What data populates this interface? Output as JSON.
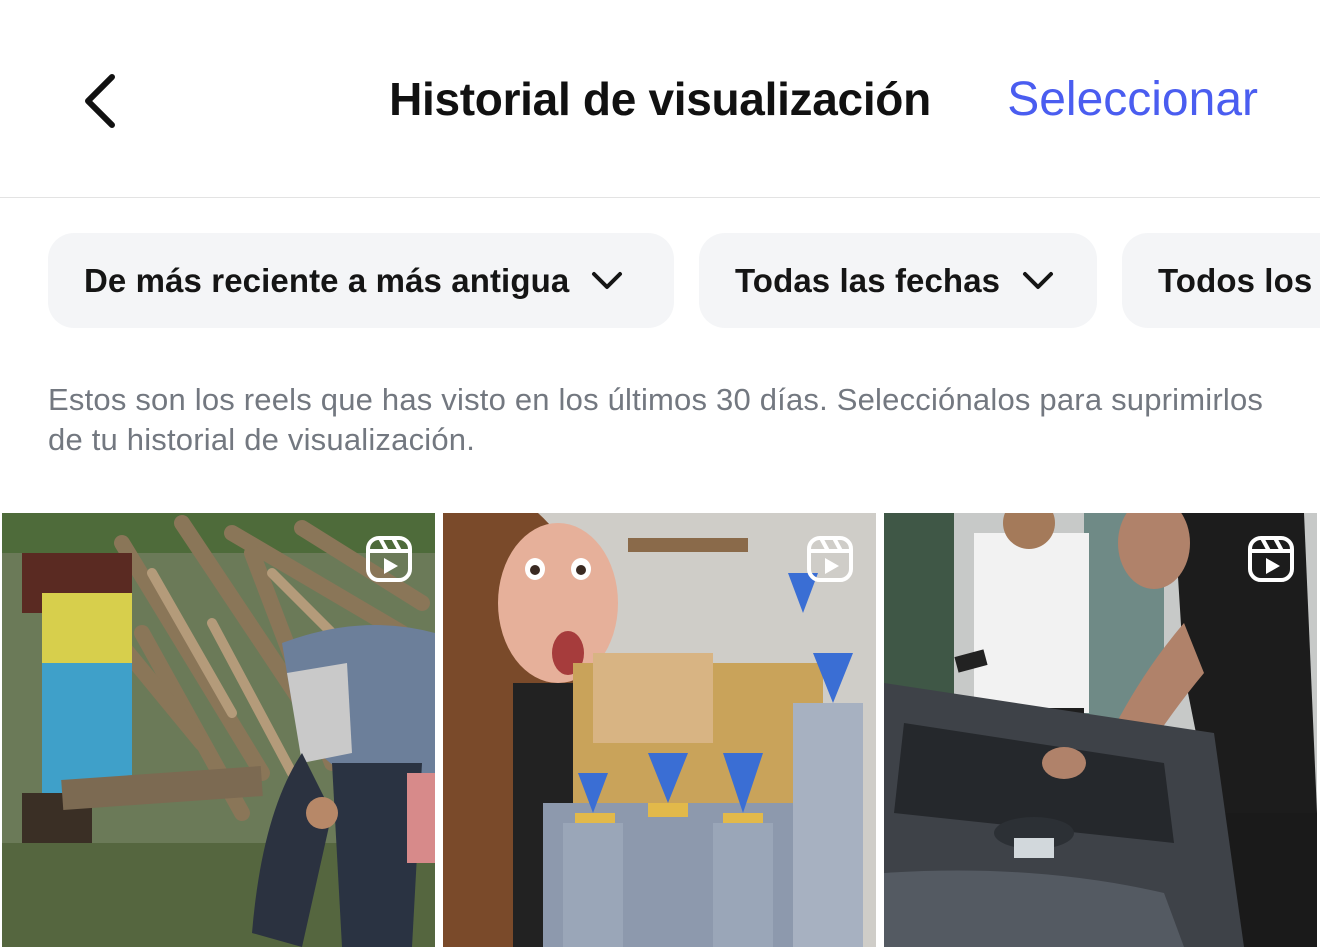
{
  "header": {
    "back_label": "Atrás",
    "title": "Historial de visualización",
    "select_label": "Seleccionar"
  },
  "filters": [
    {
      "label": "De más reciente a más antigua",
      "has_dropdown": true
    },
    {
      "label": "Todas las fechas",
      "has_dropdown": true
    },
    {
      "label": "Todos los",
      "has_dropdown": false
    }
  ],
  "description": "Estos son los reels que has visto en los últimos 30 días. Selecciónalos para suprimirlos de tu historial de visualización.",
  "reels": [
    {
      "icon": "reels-icon"
    },
    {
      "icon": "reels-icon"
    },
    {
      "icon": "reels-icon"
    }
  ],
  "colors": {
    "accent": "#4a5df0",
    "chip_background": "#f4f5f7",
    "description_text": "#737880",
    "divider": "#e3e3e3"
  }
}
